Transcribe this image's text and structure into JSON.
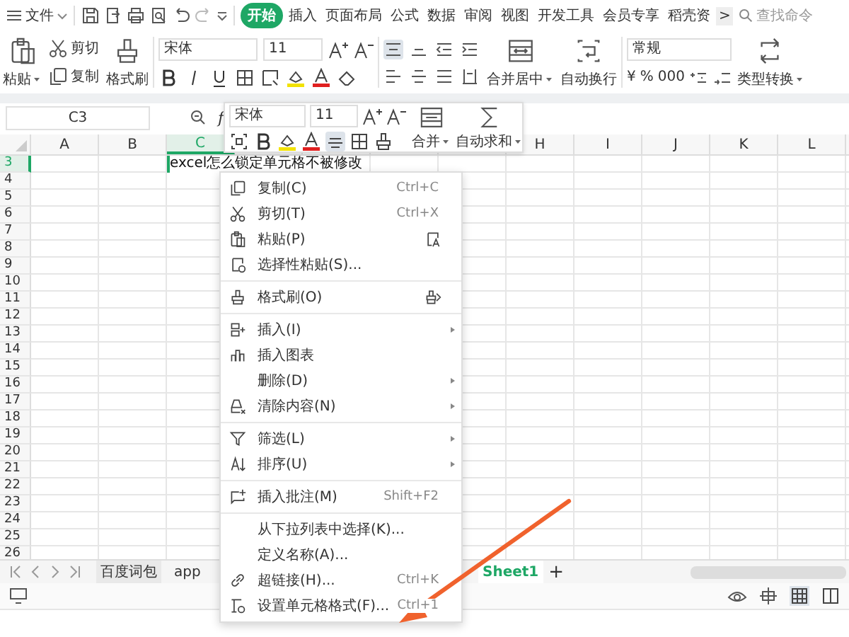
{
  "menu_bar": {
    "file_label": "文件",
    "tabs": [
      {
        "label": "开始",
        "selected": true
      },
      {
        "label": "插入",
        "selected": false
      },
      {
        "label": "页面布局",
        "selected": false
      },
      {
        "label": "公式",
        "selected": false
      },
      {
        "label": "数据",
        "selected": false
      },
      {
        "label": "审阅",
        "selected": false
      },
      {
        "label": "视图",
        "selected": false
      },
      {
        "label": "开发工具",
        "selected": false
      },
      {
        "label": "会员专享",
        "selected": false
      },
      {
        "label": "稻壳资",
        "selected": false
      }
    ],
    "more": ">",
    "search_placeholder": "查找命令"
  },
  "ribbon": {
    "paste": "粘贴",
    "cut": "剪切",
    "copy": "复制",
    "format_painter": "格式刷",
    "font": "宋体",
    "font_size": "11",
    "merge": "合并居中",
    "wrap": "自动换行",
    "number_format": "常规",
    "number_symbols": [
      "¥",
      "%",
      "000"
    ],
    "convert": "类型转换"
  },
  "formula_bar": {
    "name_box": "C3",
    "function_label": "f"
  },
  "mini_toolbar": {
    "font": "宋体",
    "font_size": "11",
    "merge": "合并",
    "autosum": "自动求和"
  },
  "sheet": {
    "columns": [
      {
        "label": "A",
        "selected": false
      },
      {
        "label": "B",
        "selected": false
      },
      {
        "label": "C",
        "selected": true
      },
      {
        "label": "H",
        "selected": false
      },
      {
        "label": "I",
        "selected": false
      },
      {
        "label": "J",
        "selected": false
      },
      {
        "label": "K",
        "selected": false
      },
      {
        "label": "L",
        "selected": false
      }
    ],
    "rows": [
      {
        "number": "3",
        "selected": true
      },
      {
        "number": "4",
        "selected": false
      },
      {
        "number": "5",
        "selected": false
      },
      {
        "number": "6",
        "selected": false
      },
      {
        "number": "7",
        "selected": false
      },
      {
        "number": "8",
        "selected": false
      },
      {
        "number": "9",
        "selected": false
      },
      {
        "number": "10",
        "selected": false
      },
      {
        "number": "11",
        "selected": false
      },
      {
        "number": "12",
        "selected": false
      },
      {
        "number": "13",
        "selected": false
      },
      {
        "number": "14",
        "selected": false
      },
      {
        "number": "15",
        "selected": false
      },
      {
        "number": "16",
        "selected": false
      },
      {
        "number": "17",
        "selected": false
      },
      {
        "number": "18",
        "selected": false
      },
      {
        "number": "19",
        "selected": false
      },
      {
        "number": "20",
        "selected": false
      },
      {
        "number": "21",
        "selected": false
      },
      {
        "number": "22",
        "selected": false
      },
      {
        "number": "23",
        "selected": false
      },
      {
        "number": "24",
        "selected": false
      },
      {
        "number": "25",
        "selected": false
      },
      {
        "number": "26",
        "selected": false
      }
    ],
    "active_cell_text": "excel怎么锁定单元格不被修改"
  },
  "context_menu": {
    "groups": [
      [
        {
          "label": "复制(C)",
          "shortcut": "Ctrl+C",
          "submenu": false
        },
        {
          "label": "剪切(T)",
          "shortcut": "Ctrl+X",
          "submenu": false
        },
        {
          "label": "粘贴(P)",
          "submenu": false
        },
        {
          "label": "选择性粘贴(S)...",
          "submenu": false
        }
      ],
      [
        {
          "label": "格式刷(O)",
          "submenu": false
        }
      ],
      [
        {
          "label": "插入(I)",
          "submenu": true
        },
        {
          "label": "插入图表",
          "submenu": false
        },
        {
          "label": "删除(D)",
          "submenu": true
        },
        {
          "label": "清除内容(N)",
          "submenu": true
        }
      ],
      [
        {
          "label": "筛选(L)",
          "submenu": true
        },
        {
          "label": "排序(U)",
          "submenu": true
        }
      ],
      [
        {
          "label": "插入批注(M)",
          "shortcut": "Shift+F2",
          "submenu": false
        }
      ],
      [
        {
          "label": "从下拉列表中选择(K)...",
          "submenu": false
        },
        {
          "label": "定义名称(A)...",
          "submenu": false
        },
        {
          "label": "超链接(H)...",
          "shortcut": "Ctrl+K",
          "submenu": false
        },
        {
          "label": "设置单元格格式(F)...",
          "shortcut": "Ctrl+1",
          "submenu": false
        }
      ]
    ]
  },
  "sheet_tabs": {
    "tabs": [
      {
        "label": "百度词包",
        "selected": false
      },
      {
        "label": "app",
        "selected": false
      },
      {
        "label": "Sheet1",
        "selected": true
      }
    ],
    "add": "+"
  }
}
